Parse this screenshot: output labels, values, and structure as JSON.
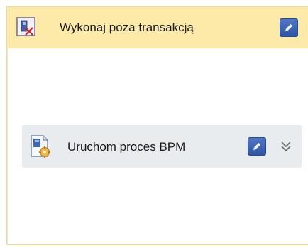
{
  "scope": {
    "title": "Wykonaj poza transakcją",
    "icon": "no-transaction-icon",
    "edit_icon": "pencil-icon"
  },
  "activity": {
    "title": "Uruchom proces BPM",
    "icon": "start-bpm-process-icon",
    "edit_icon": "pencil-icon",
    "expand_icon": "double-chevron-down-icon"
  },
  "colors": {
    "scope_header": "#fde9a8",
    "activity_background": "#e9ecef",
    "edit_button": "#3a63b4"
  }
}
